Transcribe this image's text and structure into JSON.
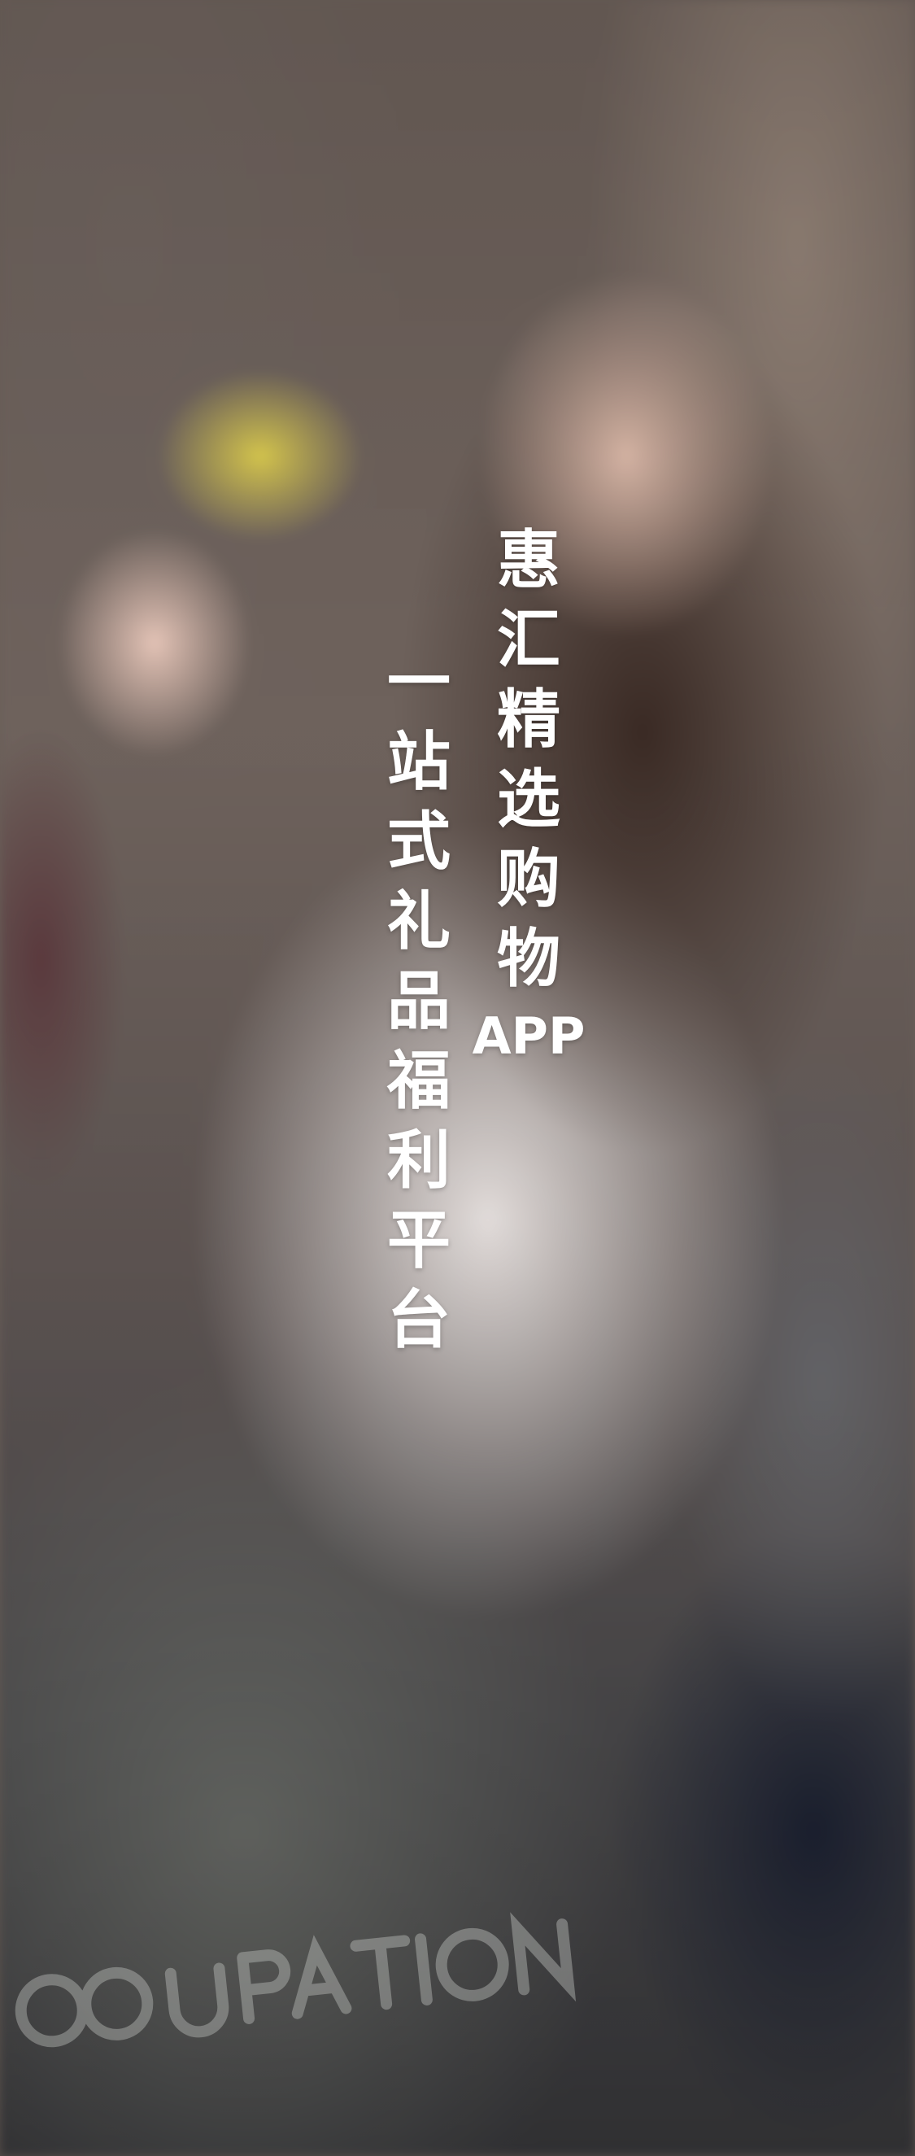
{
  "splash": {
    "title_chars": [
      "惠",
      "汇",
      "精",
      "选",
      "购",
      "物"
    ],
    "title_suffix": "APP",
    "subtitle_chars": [
      "一",
      "站",
      "式",
      "礼",
      "品",
      "福",
      "利",
      "平",
      "台"
    ]
  },
  "background": {
    "description_colors": {
      "wall": "#6e625c",
      "sweater": "#e9e3e1",
      "hair": "#3a2a24",
      "card": "#d8c84e",
      "bag": "#6a6c68",
      "jeans": "#1d2233"
    }
  }
}
